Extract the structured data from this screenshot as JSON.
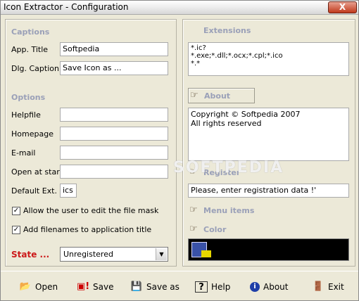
{
  "window": {
    "title": "Icon Extractor - Configuration",
    "close_label": "X"
  },
  "captions": {
    "title": "Captions",
    "app_title_label": "App. Title",
    "app_title_value": "Softpedia",
    "dlg_caption_label": "Dlg. Caption",
    "dlg_caption_value": "Save Icon as ..."
  },
  "options": {
    "title": "Options",
    "helpfile_label": "Helpfile",
    "helpfile_value": "",
    "homepage_label": "Homepage",
    "homepage_value": "",
    "email_label": "E-mail",
    "email_value": "",
    "open_start_label": "Open at start",
    "open_start_value": "",
    "default_ext_label": "Default Ext.",
    "default_ext_value": "ics",
    "cb1_label": "Allow the user to edit the file mask",
    "cb1_checked": true,
    "cb2_label": "Add filenames to application title",
    "cb2_checked": true
  },
  "state": {
    "label": "State ...",
    "value": "Unregistered"
  },
  "extensions": {
    "title": "Extensions",
    "lines": [
      "*.ic?",
      "*.exe;*.dll;*.ocx;*.cpl;*.ico",
      "*.*"
    ]
  },
  "about": {
    "title": "About",
    "lines": [
      "Copyright © Softpedia 2007",
      " All rights reserved"
    ]
  },
  "register": {
    "title": "Register",
    "value": "Please, enter registration data !'"
  },
  "menu_items": {
    "title": "Menu items"
  },
  "color": {
    "title": "Color"
  },
  "toolbar": {
    "open": "Open",
    "save_bang": "Save",
    "save_as": "Save as",
    "help": "Help",
    "about": "About",
    "exit": "Exit"
  },
  "watermark": "SOFTPEDIA",
  "colors": {
    "section_title": "#9aa0b8",
    "state_label": "#cc1a1a"
  }
}
